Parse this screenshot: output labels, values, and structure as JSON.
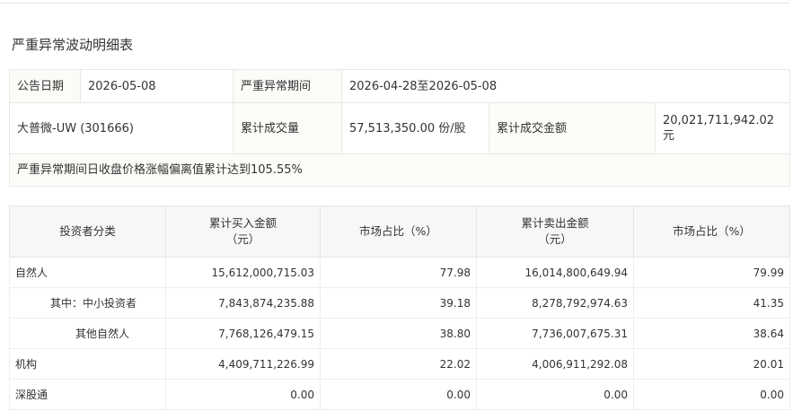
{
  "section_title": "严重异常波动明细表",
  "info": {
    "announce_date_label": "公告日期",
    "announce_date_value": "2026-05-08",
    "period_label": "严重异常期间",
    "period_value": "2026-04-28至2026-05-08",
    "stock_name": "大普微-UW (301666)",
    "volume_label": "累计成交量",
    "volume_value": "57,513,350.00 份/股",
    "amount_label": "累计成交金额",
    "amount_value": "20,021,711,942.02 元",
    "summary": "严重异常期间日收盘价格涨幅偏离值累计达到105.55%"
  },
  "trade": {
    "headers": {
      "category": "投资者分类",
      "buy_amount_line1": "累计买入金额",
      "buy_amount_line2": "（元）",
      "buy_share": "市场占比（%）",
      "sell_amount_line1": "累计卖出金额",
      "sell_amount_line2": "（元）",
      "sell_share": "市场占比（%）"
    },
    "rows": [
      {
        "category": "自然人",
        "buy": "15,612,000,715.03",
        "buy_pct": "77.98",
        "sell": "16,014,800,649.94",
        "sell_pct": "79.99"
      },
      {
        "category": "其中：中小投资者",
        "buy": "7,843,874,235.88",
        "buy_pct": "39.18",
        "sell": "8,278,792,974.63",
        "sell_pct": "41.35"
      },
      {
        "category": "其他自然人",
        "buy": "7,768,126,479.15",
        "buy_pct": "38.80",
        "sell": "7,736,007,675.31",
        "sell_pct": "38.64"
      },
      {
        "category": "机构",
        "buy": "4,409,711,226.99",
        "buy_pct": "22.02",
        "sell": "4,006,911,292.08",
        "sell_pct": "20.01"
      },
      {
        "category": "深股通",
        "buy": "0.00",
        "buy_pct": "0.00",
        "sell": "0.00",
        "sell_pct": "0.00"
      }
    ]
  }
}
